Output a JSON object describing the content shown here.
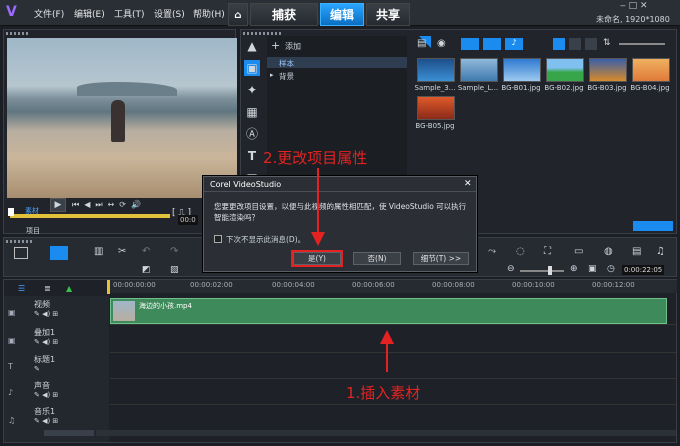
{
  "titlebar": {
    "menus": [
      "文件(F)",
      "编辑(E)",
      "工具(T)",
      "设置(S)",
      "帮助(H)"
    ],
    "tabs": {
      "capture": "捕获",
      "edit": "编辑",
      "share": "共享"
    },
    "project_info": "未命名, 1920*1080"
  },
  "library": {
    "add_label": "添加",
    "folders": [
      "样本",
      "背景"
    ],
    "items": [
      {
        "label": "Sample_3...",
        "color": "#3b8fd4"
      },
      {
        "label": "Sample_L...",
        "color": "#5aa0d8"
      },
      {
        "label": "BG-B01.jpg",
        "color": "#2f7ad0"
      },
      {
        "label": "BG-B02.jpg",
        "color": "#37a64a"
      },
      {
        "label": "BG-B03.jpg",
        "color": "#d88a2a"
      },
      {
        "label": "BG-B04.jpg",
        "color": "#e07a3a"
      },
      {
        "label": "BG-B05.jpg",
        "color": "#c94a2a"
      }
    ]
  },
  "player": {
    "mode_project": "项目",
    "mode_clip": "素材",
    "timecode": "00:0"
  },
  "dialog": {
    "title": "Corel VideoStudio",
    "message": "您要更改项目设置，以便与此视频的属性相匹配，使 VideoStudio 可以执行智能渲染吗？",
    "checkbox_label": "下次不显示此消息(D)。",
    "yes_label": "是(Y)",
    "no_label": "否(N)",
    "details_label": "细节(T) >>"
  },
  "annotations": {
    "step2": "2.更改项目属性",
    "step1": "1.插入素材"
  },
  "timeline": {
    "timecode": "0:00:22:05",
    "ruler": [
      "00:00:00:00",
      "00:00:02:00",
      "00:00:04:00",
      "00:00:06:00",
      "00:00:08:00",
      "00:00:10:00",
      "00:00:12:00"
    ],
    "tracks": [
      "视频",
      "叠加1",
      "标题1",
      "声音",
      "音乐1"
    ],
    "clip_name": "海边的小孩.mp4"
  },
  "colors": {
    "accent": "#1a8cf0",
    "clip": "#3f8a5a",
    "annotation": "#e52222"
  }
}
